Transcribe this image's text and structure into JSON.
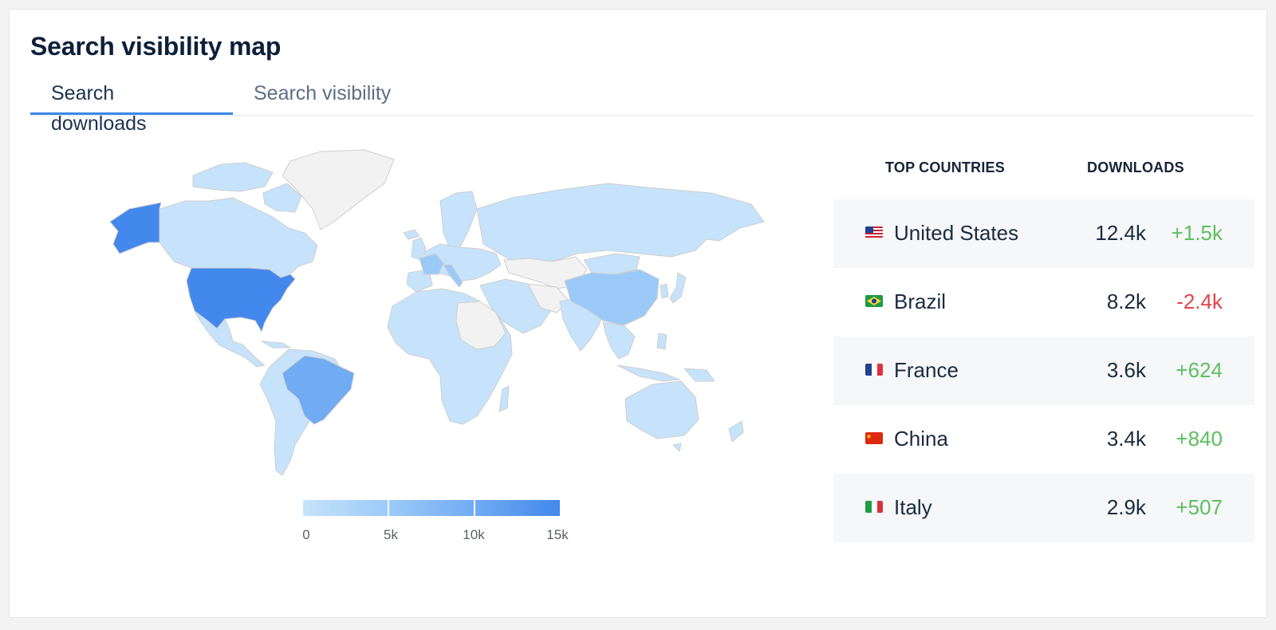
{
  "card": {
    "title": "Search visibility map"
  },
  "tabs": [
    {
      "label": "Search downloads",
      "active": true
    },
    {
      "label": "Search visibility",
      "active": false
    }
  ],
  "map": {
    "metric": "Search downloads",
    "scale_min": 0,
    "scale_max": 15000,
    "legend_ticks": [
      "0",
      "5k",
      "10k",
      "15k"
    ],
    "legend_colors": [
      "#c6e3fb",
      "#9ccaf8",
      "#70abf3",
      "#4388ec"
    ],
    "no_data_color": "#f2f2f2",
    "border_color": "#cfcfcf",
    "countries_with_data": [
      {
        "name": "United States",
        "downloads": 12400
      },
      {
        "name": "Brazil",
        "downloads": 8200
      },
      {
        "name": "France",
        "downloads": 3600
      },
      {
        "name": "China",
        "downloads": 3400
      },
      {
        "name": "Italy",
        "downloads": 2900
      }
    ]
  },
  "table": {
    "col_country": "TOP COUNTRIES",
    "col_downloads": "DOWNLOADS",
    "rows": [
      {
        "flag": "us-flag",
        "country": "United States",
        "downloads": "12.4k",
        "change": "+1.5k",
        "trend": "up"
      },
      {
        "flag": "br-flag",
        "country": "Brazil",
        "downloads": "8.2k",
        "change": "-2.4k",
        "trend": "down"
      },
      {
        "flag": "fr-flag",
        "country": "France",
        "downloads": "3.6k",
        "change": "+624",
        "trend": "up"
      },
      {
        "flag": "cn-flag",
        "country": "China",
        "downloads": "3.4k",
        "change": "+840",
        "trend": "up"
      },
      {
        "flag": "it-flag",
        "country": "Italy",
        "downloads": "2.9k",
        "change": "+507",
        "trend": "up"
      }
    ]
  },
  "colors": {
    "accent": "#3a86e6",
    "positive": "#5cbf60",
    "negative": "#e2434e"
  }
}
